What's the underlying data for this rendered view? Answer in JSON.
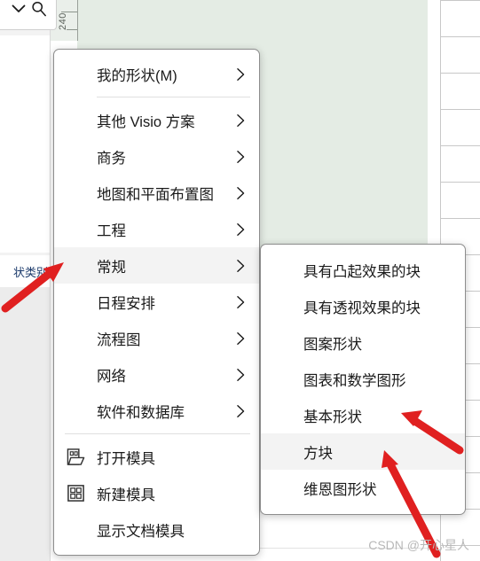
{
  "app": {
    "canvas_accent": "#e4ece4",
    "menu_highlight": "#f3f3f3",
    "annotation_color": "#e02020",
    "ruler_label": "240",
    "left_panel_partial_label": "状类别",
    "chevron_icon": "chevron-down-icon",
    "search_icon": "search-icon"
  },
  "context_menu": {
    "items": [
      {
        "label": "我的形状(M)",
        "has_submenu": true,
        "icon": null,
        "highlighted": false,
        "separator_after": true
      },
      {
        "label": "其他 Visio 方案",
        "has_submenu": true,
        "icon": null,
        "highlighted": false,
        "separator_after": false
      },
      {
        "label": "商务",
        "has_submenu": true,
        "icon": null,
        "highlighted": false,
        "separator_after": false
      },
      {
        "label": "地图和平面布置图",
        "has_submenu": true,
        "icon": null,
        "highlighted": false,
        "separator_after": false
      },
      {
        "label": "工程",
        "has_submenu": true,
        "icon": null,
        "highlighted": false,
        "separator_after": false
      },
      {
        "label": "常规",
        "has_submenu": true,
        "icon": null,
        "highlighted": true,
        "separator_after": false
      },
      {
        "label": "日程安排",
        "has_submenu": true,
        "icon": null,
        "highlighted": false,
        "separator_after": false
      },
      {
        "label": "流程图",
        "has_submenu": true,
        "icon": null,
        "highlighted": false,
        "separator_after": false
      },
      {
        "label": "网络",
        "has_submenu": true,
        "icon": null,
        "highlighted": false,
        "separator_after": false
      },
      {
        "label": "软件和数据库",
        "has_submenu": true,
        "icon": null,
        "highlighted": false,
        "separator_after": true
      },
      {
        "label": "打开模具",
        "has_submenu": false,
        "icon": "open-stencil-icon",
        "highlighted": false,
        "separator_after": false
      },
      {
        "label": "新建模具",
        "has_submenu": false,
        "icon": "new-stencil-icon",
        "highlighted": false,
        "separator_after": false
      },
      {
        "label": "显示文档模具",
        "has_submenu": false,
        "icon": null,
        "highlighted": false,
        "separator_after": false
      }
    ]
  },
  "submenu": {
    "parent_label": "常规",
    "items": [
      {
        "label": "具有凸起效果的块",
        "highlighted": false
      },
      {
        "label": "具有透视效果的块",
        "highlighted": false
      },
      {
        "label": "图案形状",
        "highlighted": false
      },
      {
        "label": "图表和数学图形",
        "highlighted": false
      },
      {
        "label": "基本形状",
        "highlighted": false
      },
      {
        "label": "方块",
        "highlighted": true
      },
      {
        "label": "维恩图形状",
        "highlighted": false
      }
    ]
  },
  "watermark": {
    "text": "CSDN @开心星人"
  }
}
